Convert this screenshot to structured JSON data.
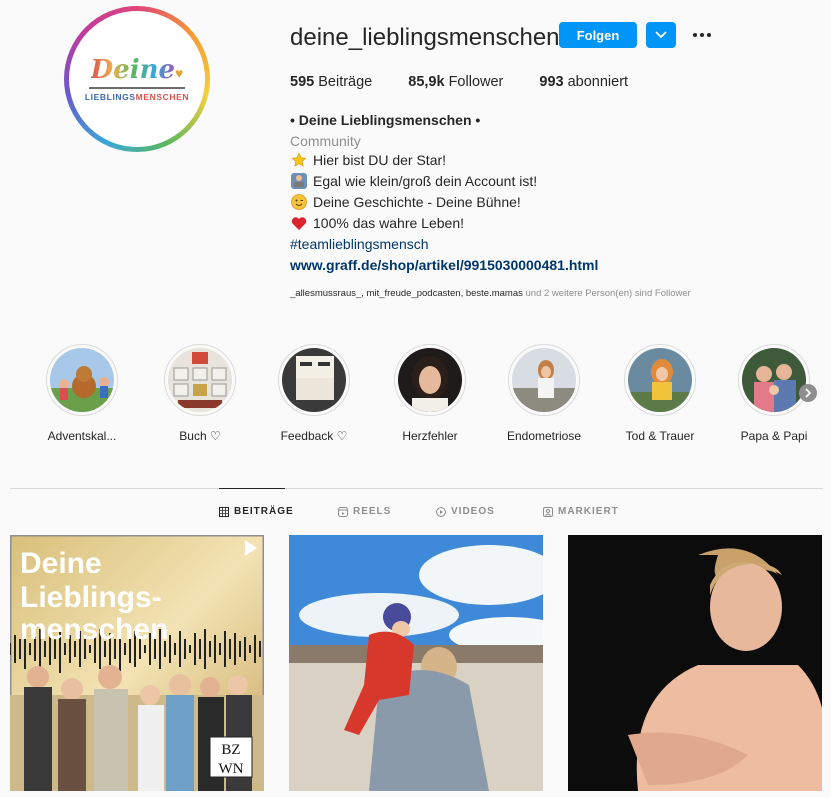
{
  "profile": {
    "username": "deine_lieblingsmenschen",
    "logo_top": "Deine",
    "logo_bottom_a": "LIEBLINGS",
    "logo_bottom_b": "MENSCHEN",
    "follow_label": "Folgen",
    "more_label": "•••"
  },
  "stats": {
    "posts_value": "595",
    "posts_label": " Beiträge",
    "followers_value": "85,9k",
    "followers_label": " Follower",
    "following_value": "993",
    "following_label": " abonniert"
  },
  "bio": {
    "name": "• Deine Lieblingsmenschen •",
    "category": "Community",
    "lines": [
      {
        "icon": "star-icon",
        "text": "Hier bist DU der Star!"
      },
      {
        "icon": "person-laptop-icon",
        "text": "Egal wie klein/groß dein Account ist!"
      },
      {
        "icon": "wink-face-icon",
        "text": "Deine Geschichte - Deine Bühne!"
      },
      {
        "icon": "red-heart-icon",
        "text": "100% das wahre Leben!"
      }
    ],
    "hashtag": "#teamlieblingsmensch",
    "link": "www.graff.de/shop/artikel/9915030000481.html",
    "followed_by_users": "_allesmussraus_, mit_freude_podcasten, beste.mamas",
    "followed_by_rest": " und 2 weitere Person(en) sind Follower"
  },
  "highlights": [
    {
      "label": "Adventskal..."
    },
    {
      "label": "Buch ♡"
    },
    {
      "label": "Feedback ♡"
    },
    {
      "label": "Herzfehler"
    },
    {
      "label": "Endometriose"
    },
    {
      "label": "Tod & Trauer"
    },
    {
      "label": "Papa & Papi"
    }
  ],
  "tabs": {
    "posts": "BEITRÄGE",
    "reels": "REELS",
    "videos": "VIDEOS",
    "tagged": "MARKIERT"
  },
  "posts": {
    "post1_title_a": "Deine",
    "post1_title_b": "Lieblings-",
    "post1_title_c": "menschen",
    "post1_badge_a": "BZ",
    "post1_badge_b": "WN"
  },
  "colors": {
    "accent": "#0095f6",
    "link": "#00376b",
    "muted": "#8e8e8e"
  }
}
